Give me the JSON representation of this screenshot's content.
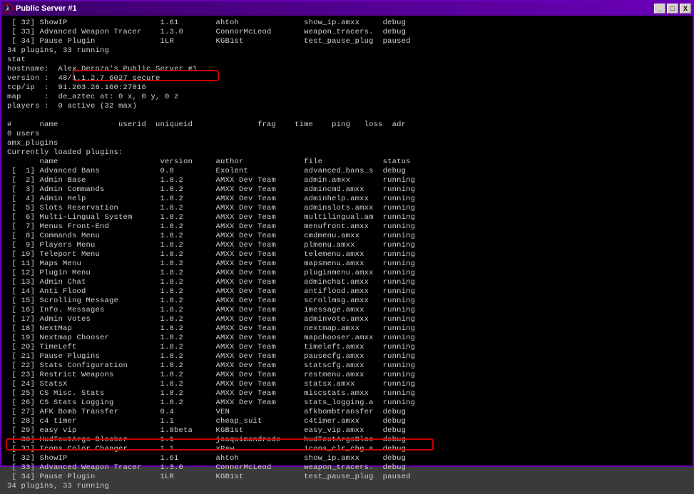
{
  "titlebar": {
    "title": "Public Server #1",
    "icon": "λ",
    "min": "_",
    "max": "□",
    "close": "X"
  },
  "top_plugins": [
    {
      "idx": "[ 32]",
      "name": "ShowIP",
      "ver": "1.61",
      "author": "ahtoh",
      "file": "show_ip.amxx",
      "status": "debug"
    },
    {
      "idx": "[ 33]",
      "name": "Advanced Weapon Tracer",
      "ver": "1.3.0",
      "author": "ConnorMcLeod",
      "file": "weapon_tracers.",
      "status": "debug"
    },
    {
      "idx": "[ 34]",
      "name": "Pause Plugin",
      "ver": "1LR",
      "author": "KGB1st",
      "file": "test_pause_plug",
      "status": "paused"
    }
  ],
  "summary1": "34 plugins, 33 running",
  "stat_cmd": "stat",
  "server_info": {
    "hostname": "hostname:  Alex Deroza's Public Server #1",
    "version": "version :  48/1.1.2.7 6027 secure",
    "tcpip": "tcp/ip  :  91.203.26.160:27016",
    "map": "map     :  de_aztec at: 0 x, 0 y, 0 z",
    "players": "players :  0 active (32 max)"
  },
  "users_header": "#      name             userid  uniqueid              frag    time    ping   loss  adr",
  "users_count": "0 users",
  "amx_cmd": "amx_plugins",
  "loaded_header": "Currently loaded plugins:",
  "col_header": {
    "name": "name",
    "ver": "version",
    "author": "author",
    "file": "file",
    "status": "status"
  },
  "plugins": [
    {
      "idx": "[  1]",
      "name": "Advanced Bans",
      "ver": "0.8",
      "author": "Exolent",
      "file": "advanced_bans_s",
      "status": "debug"
    },
    {
      "idx": "[  2]",
      "name": "Admin Base",
      "ver": "1.8.2",
      "author": "AMXX Dev Team",
      "file": "admin.amxx",
      "status": "running"
    },
    {
      "idx": "[  3]",
      "name": "Admin Commands",
      "ver": "1.8.2",
      "author": "AMXX Dev Team",
      "file": "admincmd.amxx",
      "status": "running"
    },
    {
      "idx": "[  4]",
      "name": "Admin Help",
      "ver": "1.8.2",
      "author": "AMXX Dev Team",
      "file": "adminhelp.amxx",
      "status": "running"
    },
    {
      "idx": "[  5]",
      "name": "Slots Reservation",
      "ver": "1.8.2",
      "author": "AMXX Dev Team",
      "file": "adminslots.amxx",
      "status": "running"
    },
    {
      "idx": "[  6]",
      "name": "Multi-Lingual System",
      "ver": "1.8.2",
      "author": "AMXX Dev Team",
      "file": "multilingual.am",
      "status": "running"
    },
    {
      "idx": "[  7]",
      "name": "Menus Front-End",
      "ver": "1.8.2",
      "author": "AMXX Dev Team",
      "file": "menufront.amxx",
      "status": "running"
    },
    {
      "idx": "[  8]",
      "name": "Commands Menu",
      "ver": "1.8.2",
      "author": "AMXX Dev Team",
      "file": "cmdmenu.amxx",
      "status": "running"
    },
    {
      "idx": "[  9]",
      "name": "Players Menu",
      "ver": "1.8.2",
      "author": "AMXX Dev Team",
      "file": "plmenu.amxx",
      "status": "running"
    },
    {
      "idx": "[ 10]",
      "name": "Teleport Menu",
      "ver": "1.8.2",
      "author": "AMXX Dev Team",
      "file": "telemenu.amxx",
      "status": "running"
    },
    {
      "idx": "[ 11]",
      "name": "Maps Menu",
      "ver": "1.8.2",
      "author": "AMXX Dev Team",
      "file": "mapsmenu.amxx",
      "status": "running"
    },
    {
      "idx": "[ 12]",
      "name": "Plugin Menu",
      "ver": "1.8.2",
      "author": "AMXX Dev Team",
      "file": "pluginmenu.amxx",
      "status": "running"
    },
    {
      "idx": "[ 13]",
      "name": "Admin Chat",
      "ver": "1.8.2",
      "author": "AMXX Dev Team",
      "file": "adminchat.amxx",
      "status": "running"
    },
    {
      "idx": "[ 14]",
      "name": "Anti Flood",
      "ver": "1.8.2",
      "author": "AMXX Dev Team",
      "file": "antiflood.amxx",
      "status": "running"
    },
    {
      "idx": "[ 15]",
      "name": "Scrolling Message",
      "ver": "1.8.2",
      "author": "AMXX Dev Team",
      "file": "scrollmsg.amxx",
      "status": "running"
    },
    {
      "idx": "[ 16]",
      "name": "Info. Messages",
      "ver": "1.8.2",
      "author": "AMXX Dev Team",
      "file": "imessage.amxx",
      "status": "running"
    },
    {
      "idx": "[ 17]",
      "name": "Admin Votes",
      "ver": "1.8.2",
      "author": "AMXX Dev Team",
      "file": "adminvote.amxx",
      "status": "running"
    },
    {
      "idx": "[ 18]",
      "name": "NextMap",
      "ver": "1.8.2",
      "author": "AMXX Dev Team",
      "file": "nextmap.amxx",
      "status": "running"
    },
    {
      "idx": "[ 19]",
      "name": "Nextmap Chooser",
      "ver": "1.8.2",
      "author": "AMXX Dev Team",
      "file": "mapchooser.amxx",
      "status": "running"
    },
    {
      "idx": "[ 20]",
      "name": "TimeLeft",
      "ver": "1.8.2",
      "author": "AMXX Dev Team",
      "file": "timeleft.amxx",
      "status": "running"
    },
    {
      "idx": "[ 21]",
      "name": "Pause Plugins",
      "ver": "1.8.2",
      "author": "AMXX Dev Team",
      "file": "pausecfg.amxx",
      "status": "running"
    },
    {
      "idx": "[ 22]",
      "name": "Stats Configuration",
      "ver": "1.8.2",
      "author": "AMXX Dev Team",
      "file": "statscfg.amxx",
      "status": "running"
    },
    {
      "idx": "[ 23]",
      "name": "Restrict Weapons",
      "ver": "1.8.2",
      "author": "AMXX Dev Team",
      "file": "restmenu.amxx",
      "status": "running"
    },
    {
      "idx": "[ 24]",
      "name": "StatsX",
      "ver": "1.8.2",
      "author": "AMXX Dev Team",
      "file": "statsx.amxx",
      "status": "running"
    },
    {
      "idx": "[ 25]",
      "name": "CS Misc. Stats",
      "ver": "1.8.2",
      "author": "AMXX Dev Team",
      "file": "miscstats.amxx",
      "status": "running"
    },
    {
      "idx": "[ 26]",
      "name": "CS Stats Logging",
      "ver": "1.8.2",
      "author": "AMXX Dev Team",
      "file": "stats_logging.a",
      "status": "running"
    },
    {
      "idx": "[ 27]",
      "name": "AFK Bomb Transfer",
      "ver": "0.4",
      "author": "VEN",
      "file": "afkbombtransfer",
      "status": "debug"
    },
    {
      "idx": "[ 28]",
      "name": "c4 timer",
      "ver": "1.1",
      "author": "cheap_suit",
      "file": "c4timer.amxx",
      "status": "debug"
    },
    {
      "idx": "[ 29]",
      "name": "easy vip",
      "ver": "1.8beta",
      "author": "KGB1st",
      "file": "easy_vip.amxx",
      "status": "debug"
    },
    {
      "idx": "[ 30]",
      "name": "HudTextArgs Blocker",
      "ver": "1.1",
      "author": "joaquimandrade",
      "file": "hudTextArgsBloc",
      "status": "debug"
    },
    {
      "idx": "[ 31]",
      "name": "Icons Color Changer",
      "ver": "1.1",
      "author": "xPaw",
      "file": "icons_clr_chg.a",
      "status": "debug"
    },
    {
      "idx": "[ 32]",
      "name": "ShowIP",
      "ver": "1.61",
      "author": "ahtoh",
      "file": "show_ip.amxx",
      "status": "debug"
    },
    {
      "idx": "[ 33]",
      "name": "Advanced Weapon Tracer",
      "ver": "1.3.0",
      "author": "ConnorMcLeod",
      "file": "weapon_tracers.",
      "status": "debug"
    },
    {
      "idx": "[ 34]",
      "name": "Pause Plugin",
      "ver": "1LR",
      "author": "KGB1st",
      "file": "test_pause_plug",
      "status": "paused"
    }
  ],
  "summary2": "34 plugins, 33 running"
}
